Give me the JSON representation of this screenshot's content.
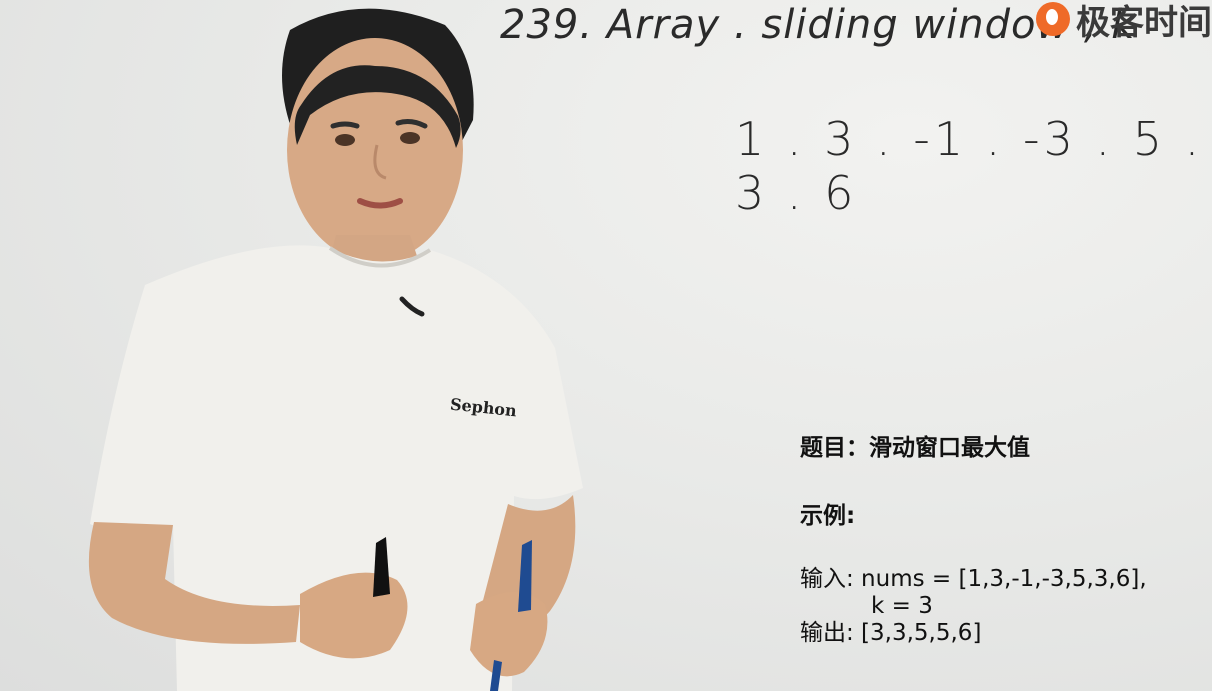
{
  "board": {
    "title_line": "239.   Array .   sliding   window , k",
    "number_line": "1 . 3 . -1 . -3 . 5 . 3 . 6"
  },
  "logo": {
    "text": "极客时间",
    "icon": "geektime-logo-icon",
    "accent": "#ef6a28"
  },
  "problem": {
    "heading": "题目：滑动窗口最大值",
    "example_label": "示例:",
    "input_line": "输入: nums = [1,3,-1,-3,5,3,6],",
    "k_line": "k = 3",
    "output_line": "输出: [3,3,5,5,6]"
  },
  "presenter": {
    "shirt_text": "Sephon"
  }
}
